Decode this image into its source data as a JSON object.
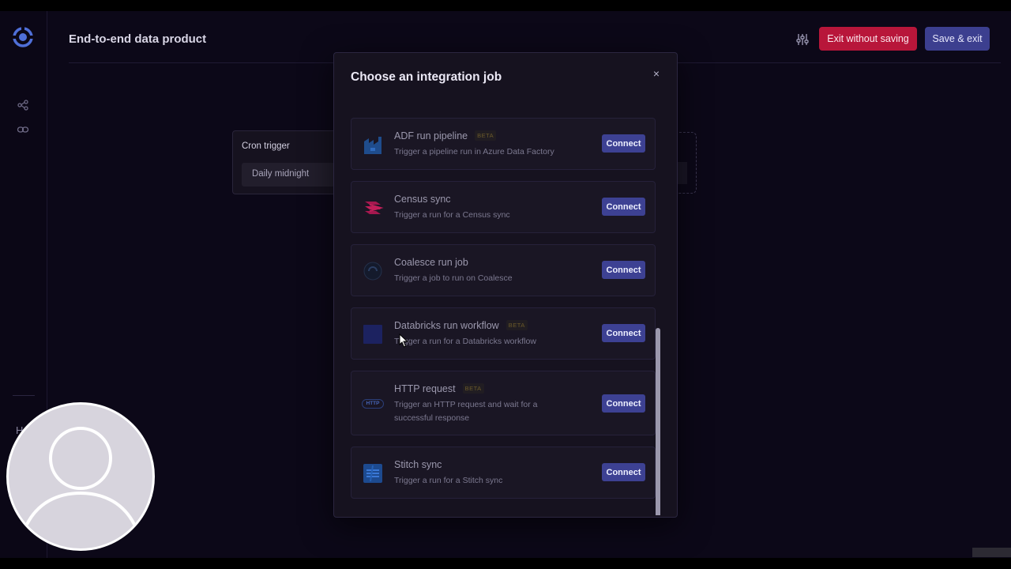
{
  "app": {
    "title": "End-to-end data product",
    "exit_label": "Exit without saving",
    "save_label": "Save & exit"
  },
  "canvas": {
    "cron_node": {
      "title": "Cron trigger",
      "value": "Daily midnight"
    }
  },
  "sidebar": {
    "partial_item": "H"
  },
  "modal": {
    "title": "Choose an integration job",
    "close_icon": "×",
    "items": [
      {
        "name": "ADF run pipeline",
        "beta": "BETA",
        "description": "Trigger a pipeline run in Azure Data Factory",
        "action": "Connect",
        "icon": "azure-data-factory-icon"
      },
      {
        "name": "Census sync",
        "beta": "",
        "description": "Trigger a run for a Census sync",
        "action": "Connect",
        "icon": "census-icon"
      },
      {
        "name": "Coalesce run job",
        "beta": "",
        "description": "Trigger a job to run on Coalesce",
        "action": "Connect",
        "icon": "coalesce-icon"
      },
      {
        "name": "Databricks run workflow",
        "beta": "BETA",
        "description": "Trigger a run for a Databricks workflow",
        "action": "Connect",
        "icon": "databricks-icon"
      },
      {
        "name": "HTTP request",
        "beta": "BETA",
        "description": "Trigger an HTTP request and wait for a successful response",
        "action": "Connect",
        "icon": "http-icon",
        "icon_text": "HTTP"
      },
      {
        "name": "Stitch sync",
        "beta": "",
        "description": "Trigger a run for a Stitch sync",
        "action": "Connect",
        "icon": "stitch-icon"
      }
    ]
  },
  "colors": {
    "background": "#0c0818",
    "exit_button": "#b8163a",
    "primary_button": "#3c3f8f",
    "modal_bg": "#16121f"
  }
}
